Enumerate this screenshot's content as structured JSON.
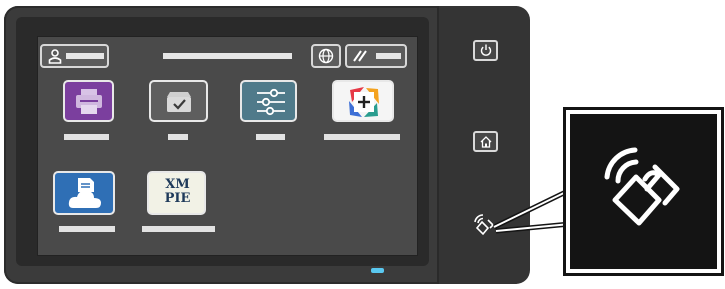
{
  "device": {
    "status_led_color": "#5ac8f0",
    "screen_bg": "#4a4a4a",
    "body_color": "#3b3b3b"
  },
  "top_bar": {
    "user_icon": "user-icon",
    "language_icon": "globe-icon",
    "energy_icon": "energy-saver-icon"
  },
  "apps": [
    {
      "name": "print-app",
      "icon": "printer-icon",
      "color": "#7b3f9e"
    },
    {
      "name": "jobs-app",
      "icon": "tray-check-icon",
      "color": "#6a6a6a"
    },
    {
      "name": "settings-app",
      "icon": "sliders-icon",
      "color": "#4f7a8a"
    },
    {
      "name": "add-app",
      "icon": "plus-icon",
      "color": "#ffffff"
    },
    {
      "name": "cloud-app",
      "icon": "cloud-document-icon",
      "color": "#2f6fb5"
    },
    {
      "name": "xmpie-app",
      "icon": "xmpie-logo",
      "color": "#f2f2e6",
      "logo_text_top": "XM",
      "logo_text_bottom": "PIE"
    }
  ],
  "hardware": {
    "power_icon": "power-icon",
    "home_icon": "home-icon",
    "nfc_icon": "nfc-icon"
  }
}
